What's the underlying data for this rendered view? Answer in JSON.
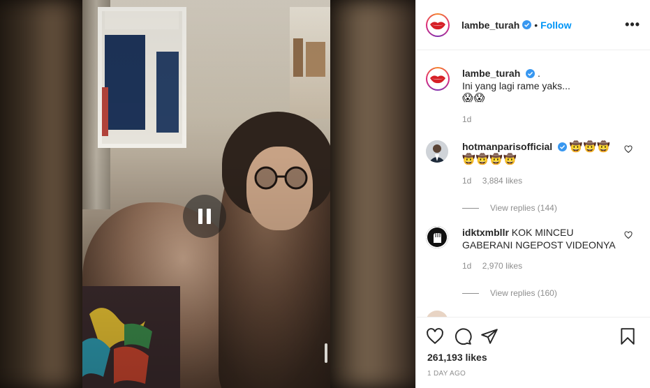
{
  "post": {
    "username": "lambe_turah",
    "follow_label": "Follow",
    "dot": "•",
    "more_label": "•••",
    "caption": {
      "username": "lambe_turah",
      "suffix": ".",
      "text": "Ini yang lagi rame yaks...",
      "emojis": "😱😱",
      "time": "1d"
    }
  },
  "comments": [
    {
      "username": "hotmanparisofficial",
      "verified": true,
      "text": "🤠🤠🤠",
      "text2": "🤠🤠🤠🤠",
      "time": "1d",
      "likes": "3,884 likes",
      "replies": "View replies (144)"
    },
    {
      "username": "idktxmbllr",
      "verified": false,
      "text": "KOK MINCEU GABERANI NGEPOST VIDEONYA",
      "time": "1d",
      "likes": "2,970 likes",
      "replies": "View replies (160)"
    }
  ],
  "actions": {
    "likes": "261,193 likes",
    "date": "1 DAY AGO"
  },
  "colors": {
    "accent": "#0095f6",
    "text": "#262626",
    "muted": "#8e8e8e",
    "border": "#efefef"
  },
  "icons": {
    "header": [
      "verified-icon",
      "more-options-icon"
    ],
    "video": [
      "pause-icon"
    ],
    "actions": [
      "heart-icon",
      "comment-icon",
      "share-icon",
      "bookmark-icon"
    ]
  }
}
